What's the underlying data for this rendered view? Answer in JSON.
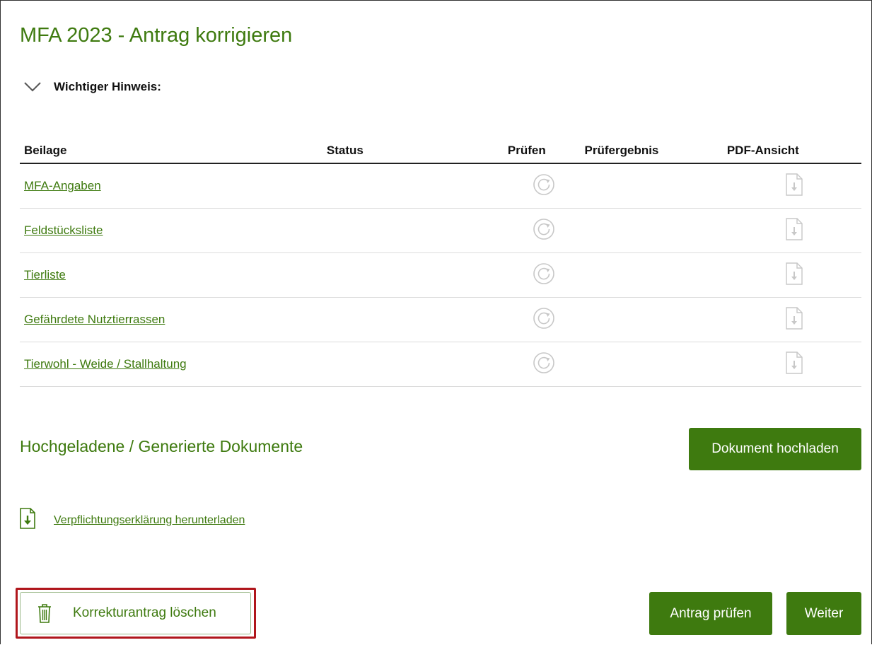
{
  "page": {
    "title": "MFA 2023 - Antrag korrigieren",
    "hint_label": "Wichtiger Hinweis:"
  },
  "table": {
    "headers": {
      "beilage": "Beilage",
      "status": "Status",
      "pruefen": "Prüfen",
      "ergebnis": "Prüfergebnis",
      "pdf": "PDF-Ansicht"
    },
    "rows": [
      {
        "label": "MFA-Angaben",
        "status": "",
        "ergebnis": ""
      },
      {
        "label": "Feldstücksliste",
        "status": "",
        "ergebnis": ""
      },
      {
        "label": "Tierliste",
        "status": "",
        "ergebnis": ""
      },
      {
        "label": "Gefährdete Nutztierrassen",
        "status": "",
        "ergebnis": ""
      },
      {
        "label": "Tierwohl - Weide / Stallhaltung",
        "status": "",
        "ergebnis": ""
      }
    ]
  },
  "documents": {
    "title": "Hochgeladene / Generierte Dokumente",
    "upload_label": "Dokument hochladen",
    "download_link": "Verpflichtungserklärung herunterladen"
  },
  "footer": {
    "delete_label": "Korrekturantrag löschen",
    "check_label": "Antrag prüfen",
    "next_label": "Weiter"
  },
  "icons": {
    "hint_toggle": "chevron-down-icon",
    "check": "refresh-icon",
    "pdf": "file-download-icon",
    "download": "file-download-icon",
    "delete": "trash-icon"
  },
  "colors": {
    "brand_green": "#3e7a0f",
    "highlight_red": "#b0161c",
    "icon_gray": "#c8c8c8"
  }
}
